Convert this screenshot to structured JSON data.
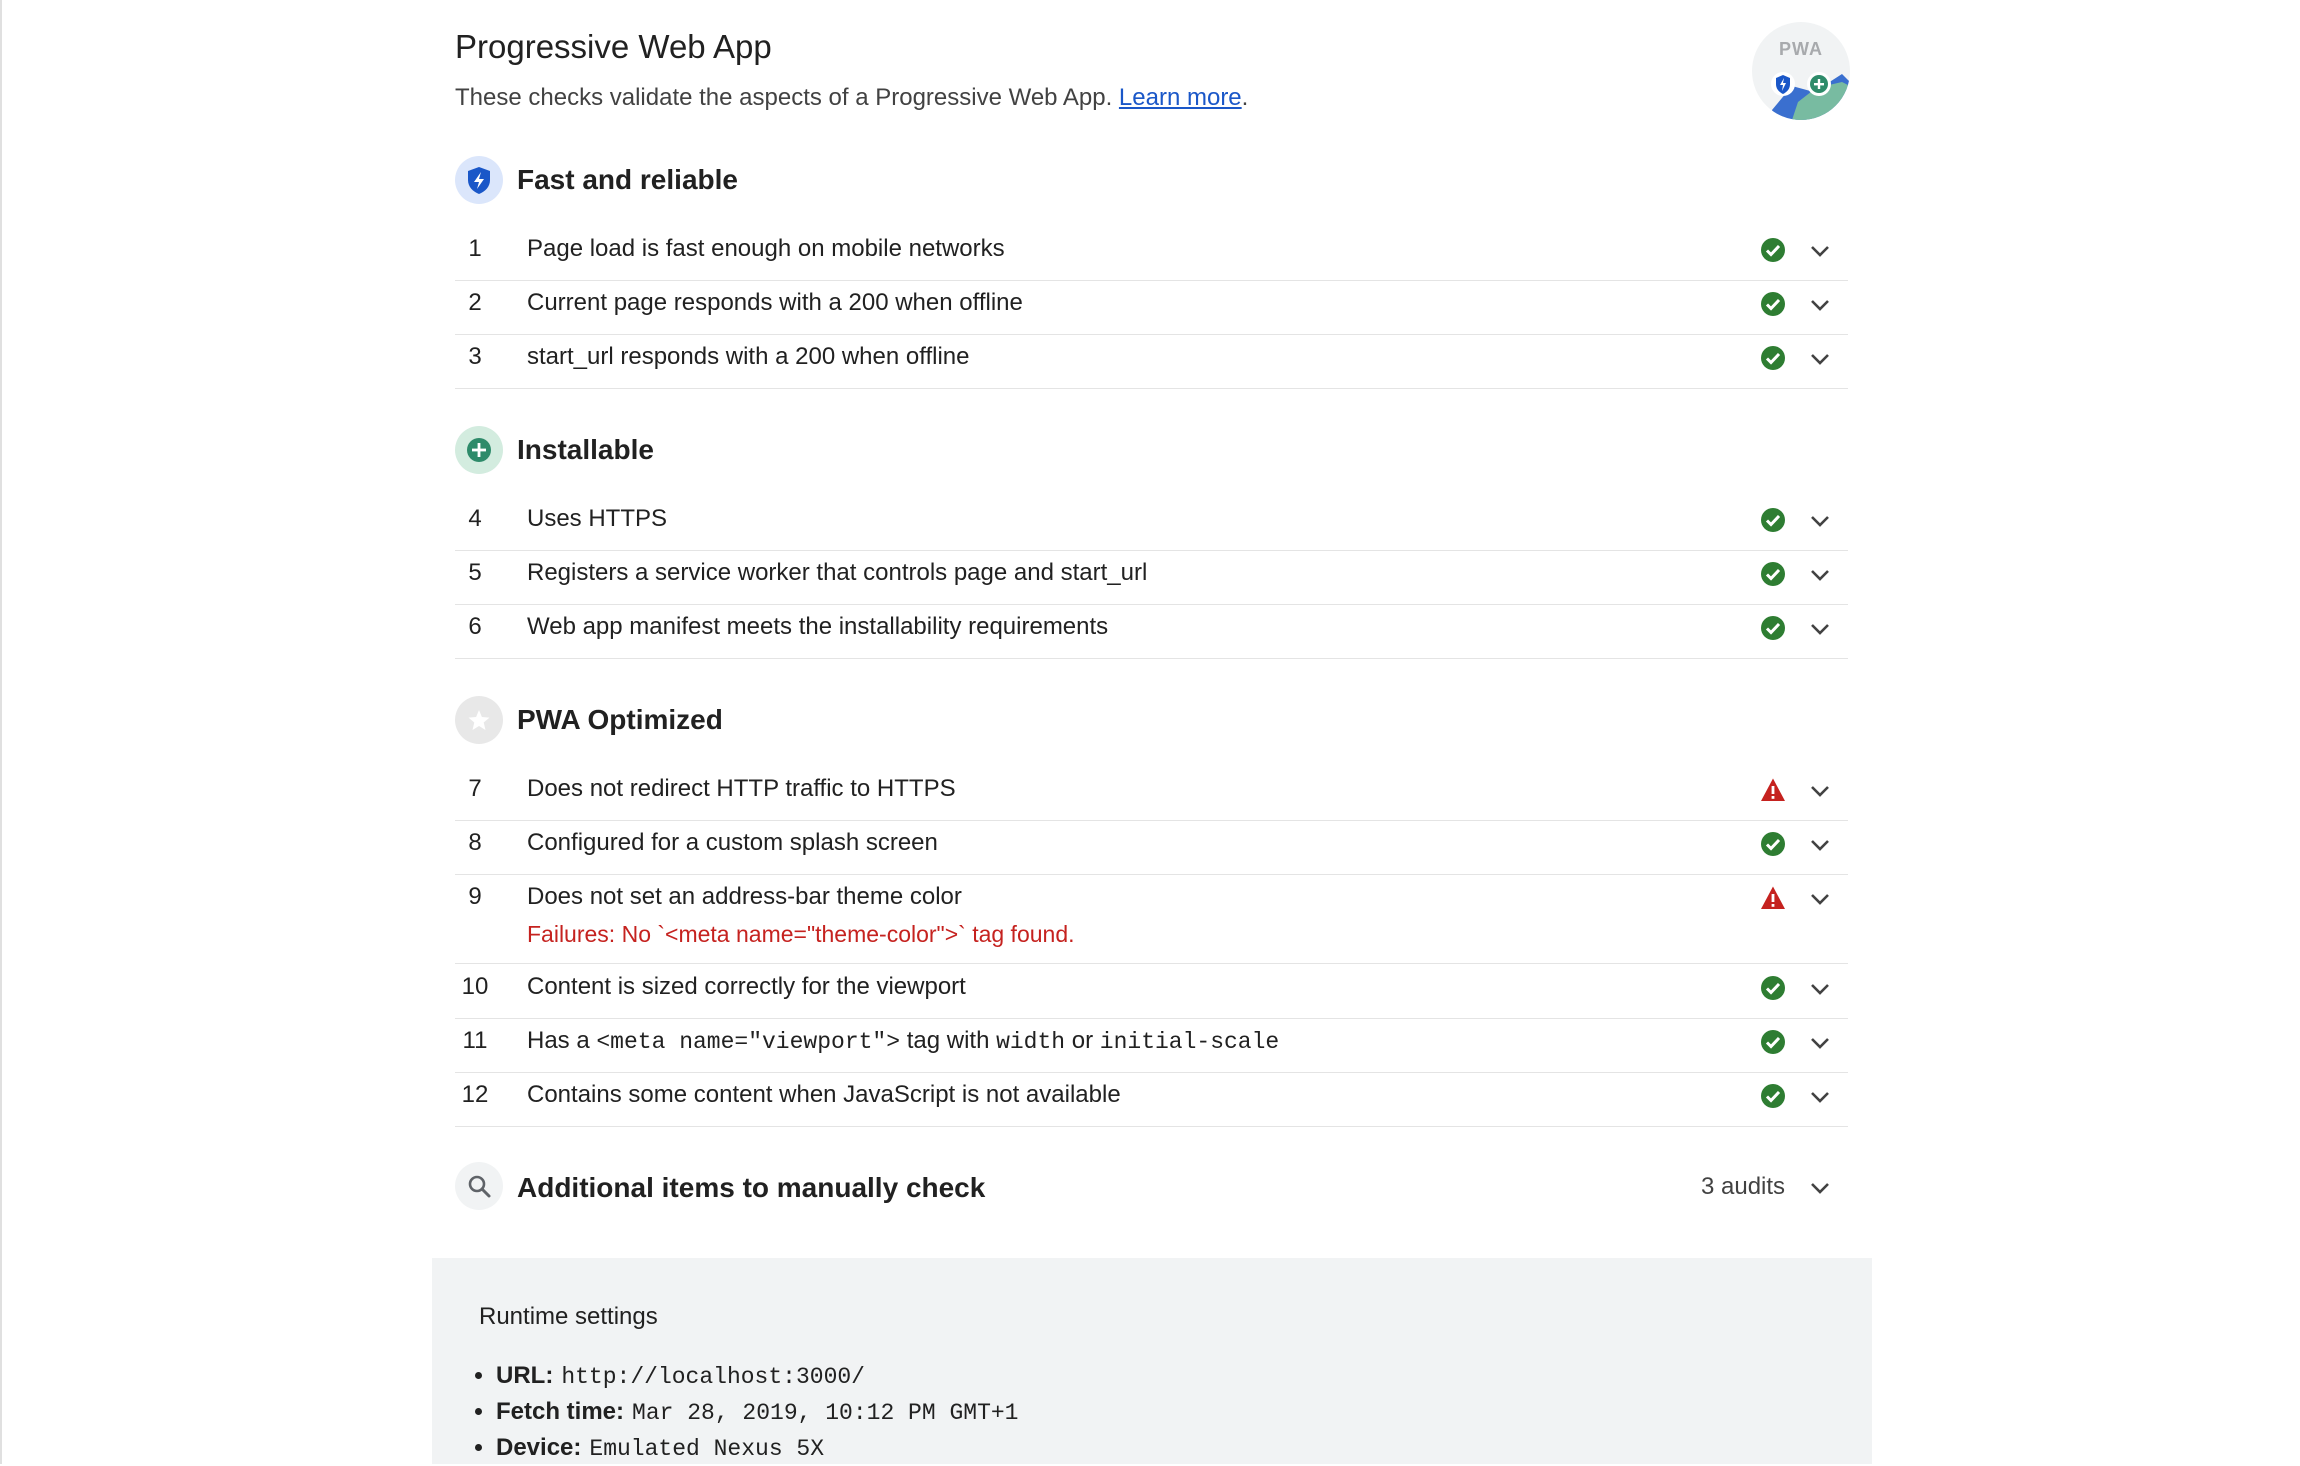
{
  "header": {
    "title": "Progressive Web App",
    "description": "These checks validate the aspects of a Progressive Web App.",
    "learn_more": "Learn more",
    "period": ".",
    "badge_text": "PWA"
  },
  "groups": [
    {
      "title": "Fast and reliable",
      "icon": "shield-bolt-icon",
      "audits": [
        {
          "index": "1",
          "label": "Page load is fast enough on mobile networks",
          "status": "pass"
        },
        {
          "index": "2",
          "label": "Current page responds with a 200 when offline",
          "status": "pass"
        },
        {
          "index": "3",
          "label": "start_url responds with a 200 when offline",
          "status": "pass"
        }
      ]
    },
    {
      "title": "Installable",
      "icon": "plus-circle-icon",
      "audits": [
        {
          "index": "4",
          "label": "Uses HTTPS",
          "status": "pass"
        },
        {
          "index": "5",
          "label": "Registers a service worker that controls page and start_url",
          "status": "pass"
        },
        {
          "index": "6",
          "label": "Web app manifest meets the installability requirements",
          "status": "pass"
        }
      ]
    },
    {
      "title": "PWA Optimized",
      "icon": "star-icon",
      "audits": [
        {
          "index": "7",
          "label": "Does not redirect HTTP traffic to HTTPS",
          "status": "fail"
        },
        {
          "index": "8",
          "label": "Configured for a custom splash screen",
          "status": "pass"
        },
        {
          "index": "9",
          "label": "Does not set an address-bar theme color",
          "status": "fail",
          "failure": "Failures: No `<meta name=\"theme-color\">` tag found."
        },
        {
          "index": "10",
          "label": "Content is sized correctly for the viewport",
          "status": "pass"
        },
        {
          "index": "11",
          "label_parts": [
            "Has a ",
            "<meta name=\"viewport\">",
            " tag with ",
            "width",
            " or ",
            "initial-scale"
          ],
          "status": "pass"
        },
        {
          "index": "12",
          "label": "Contains some content when JavaScript is not available",
          "status": "pass"
        }
      ]
    }
  ],
  "manual": {
    "title": "Additional items to manually check",
    "count": "3 audits",
    "icon": "search-icon"
  },
  "runtime": {
    "title": "Runtime settings",
    "items": [
      {
        "key": "URL:",
        "value": "http://localhost:3000/"
      },
      {
        "key": "Fetch time:",
        "value": "Mar 28, 2019, 10:12 PM GMT+1"
      },
      {
        "key": "Device:",
        "value": "Emulated Nexus 5X"
      }
    ]
  },
  "colors": {
    "pass": "#2e7d32",
    "fail": "#c5221f",
    "link": "#1a57c8",
    "fast_reliable": "#1a57c8",
    "installable": "#2e8b6a"
  }
}
